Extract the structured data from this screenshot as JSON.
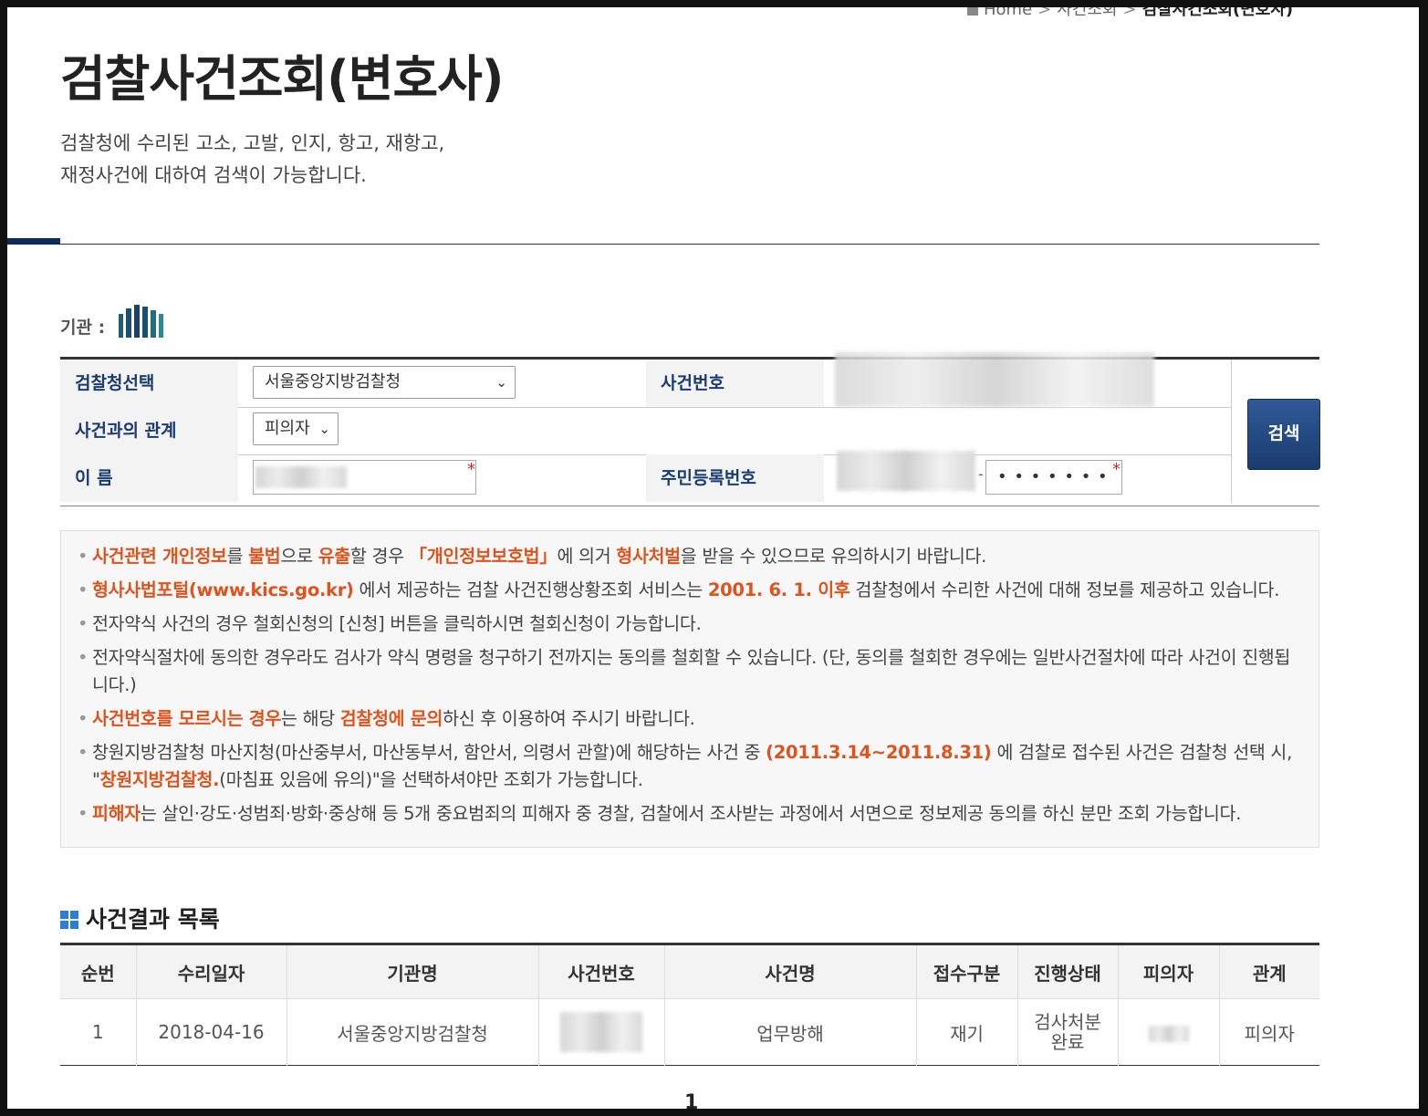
{
  "breadcrumb": {
    "home": "Home",
    "parent": "사건조회",
    "current": "검찰사건조회(변호사)"
  },
  "page": {
    "title": "검찰사건조회(변호사)",
    "desc_line1": "검찰청에 수리된 고소, 고발, 인지, 항고, 재항고,",
    "desc_line2": "재정사건에 대하여 검색이 가능합니다."
  },
  "org_label": "기관 :",
  "form": {
    "prosecutor_label": "검찰청선택",
    "prosecutor_value": "서울중앙지방검찰청",
    "case_no_label": "사건번호",
    "relation_label": "사건과의 관계",
    "relation_value": "피의자",
    "name_label": "이 름",
    "rrn_label": "주민등록번호",
    "rrn_sep": "-",
    "rrn_masked": "• • • • • • •",
    "required_mark": "*",
    "search_button": "검색"
  },
  "notices": [
    {
      "parts": [
        {
          "t": "사건관련 개인정보",
          "h": true
        },
        {
          "t": "를 "
        },
        {
          "t": "불법",
          "h": true
        },
        {
          "t": "으로 "
        },
        {
          "t": "유출",
          "h": true
        },
        {
          "t": "할 경우 "
        },
        {
          "t": "「개인정보보호법」",
          "h": true
        },
        {
          "t": "에 의거 "
        },
        {
          "t": "형사처벌",
          "h": true
        },
        {
          "t": "을 받을 수 있으므로 유의하시기 바랍니다."
        }
      ]
    },
    {
      "parts": [
        {
          "t": "형사사법포털(www.kics.go.kr)",
          "h": true
        },
        {
          "t": " 에서 제공하는 검찰 사건진행상황조회 서비스는 "
        },
        {
          "t": "2001. 6. 1. 이후",
          "h": true
        },
        {
          "t": " 검찰청에서 수리한 사건에 대해 정보를 제공하고 있습니다."
        }
      ]
    },
    {
      "parts": [
        {
          "t": "전자약식 사건의 경우 철회신청의 [신청] 버튼을 클릭하시면 철회신청이 가능합니다."
        }
      ]
    },
    {
      "parts": [
        {
          "t": "전자약식절차에 동의한 경우라도 검사가 약식 명령을 청구하기 전까지는 동의를 철회할 수 있습니다. (단, 동의를 철회한 경우에는 일반사건절차에 따라 사건이 진행됩니다.)"
        }
      ]
    },
    {
      "parts": [
        {
          "t": "사건번호를 모르시는 경우",
          "h": true
        },
        {
          "t": "는 해당 "
        },
        {
          "t": "검찰청에 문의",
          "h": true
        },
        {
          "t": "하신 후 이용하여 주시기 바랍니다."
        }
      ]
    },
    {
      "parts": [
        {
          "t": "창원지방검찰청 마산지청(마산중부서, 마산동부서, 함안서, 의령서 관할)에 해당하는 사건 중 "
        },
        {
          "t": "(2011.3.14~2011.8.31)",
          "h": true
        },
        {
          "t": " 에 검찰로 접수된 사건은 검찰청 선택 시, \""
        },
        {
          "t": "창원지방검찰청.",
          "h": true
        },
        {
          "t": "(마침표 있음에 유의)\"을 선택하셔야만 조회가 가능합니다."
        }
      ]
    },
    {
      "parts": [
        {
          "t": "피해자",
          "h": true
        },
        {
          "t": "는 살인·강도·성범죄·방화·중상해 등 5개 중요범죄의 피해자 중 경찰, 검찰에서 조사받는 과정에서 서면으로 정보제공 동의를 하신 분만 조회 가능합니다."
        }
      ]
    }
  ],
  "results": {
    "heading": "사건결과 목록",
    "columns": [
      "순번",
      "수리일자",
      "기관명",
      "사건번호",
      "사건명",
      "접수구분",
      "진행상태",
      "피의자",
      "관계"
    ],
    "rows": [
      {
        "no": "1",
        "date": "2018-04-16",
        "org": "서울중앙지방검찰청",
        "case_name": "업무방해",
        "type": "재기",
        "status_l1": "검사처분",
        "status_l2": "완료",
        "relation": "피의자"
      }
    ]
  },
  "pager": "1",
  "colors": {
    "accent": "#1a3b6e",
    "highlight": "#e0531c",
    "required": "#e0261f"
  }
}
